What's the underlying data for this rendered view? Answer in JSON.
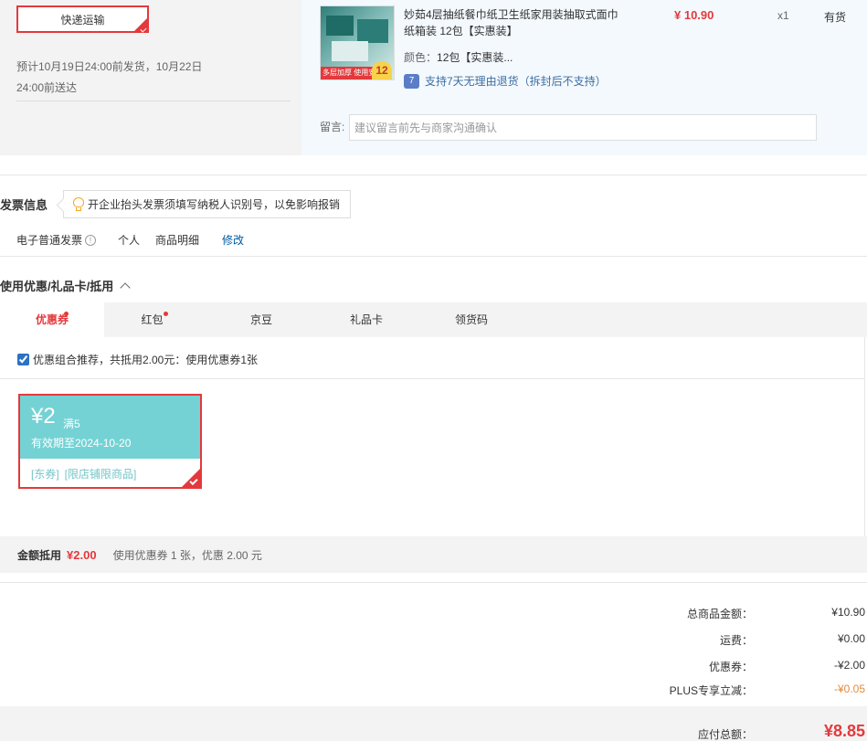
{
  "shipping": {
    "method": "快递运输",
    "estimate": "预计10月19日24:00前发货，10月22日24:00前送达"
  },
  "goods": {
    "image_tag": "多层加厚 使用安心",
    "image_badge": "12",
    "name": "妙茹4层抽纸餐巾纸卫生纸家用装抽取式面巾纸箱装 12包【实惠装】",
    "color_label": "颜色：",
    "color_value": "12包【实惠装...",
    "return_icon": "7",
    "return_policy": "支持7天无理由退货（拆封后不支持）",
    "price": "¥ 10.90",
    "qty": "x1",
    "stock": "有货",
    "memo_label": "留言:",
    "memo_placeholder": "建议留言前先与商家沟通确认"
  },
  "invoice": {
    "title": "发票信息",
    "tip": "开企业抬头发票须填写纳税人识别号，以免影响报销",
    "type": "电子普通发票",
    "info_icon": "!",
    "holder": "个人",
    "content": "商品明细",
    "edit": "修改"
  },
  "coupons": {
    "title": "使用优惠/礼品卡/抵用",
    "tabs": [
      {
        "label": "优惠券",
        "dot": true
      },
      {
        "label": "红包",
        "dot": true
      },
      {
        "label": "京豆",
        "dot": false
      },
      {
        "label": "礼品卡",
        "dot": false
      },
      {
        "label": "领货码",
        "dot": false
      }
    ],
    "combo_text": "优惠组合推荐，共抵用2.00元：使用优惠券1张",
    "combo_checked": true,
    "coupon": {
      "amount": "¥2",
      "condition": "满5",
      "expiry": "有效期至2024-10-20",
      "tag1": "[东券]",
      "tag2": "[限店铺限商品]"
    },
    "deduct_label": "金额抵用",
    "deduct_amount": "¥2.00",
    "deduct_desc": "使用优惠券 1 张，优惠 2.00 元"
  },
  "totals": {
    "goods_label": "总商品金额：",
    "goods_value": "¥10.90",
    "freight_label": "运费：",
    "freight_value": "¥0.00",
    "coupon_label": "优惠券：",
    "coupon_value": "-¥2.00",
    "plus_label": "PLUS专享立减：",
    "plus_value": "-¥0.05",
    "final_label": "应付总额：",
    "final_value": "¥8.85"
  },
  "colors": {
    "accent": "#e4393c",
    "coupon_teal": "#74d2d4",
    "link_blue": "#005aa0",
    "plus_orange": "#e4893c"
  }
}
